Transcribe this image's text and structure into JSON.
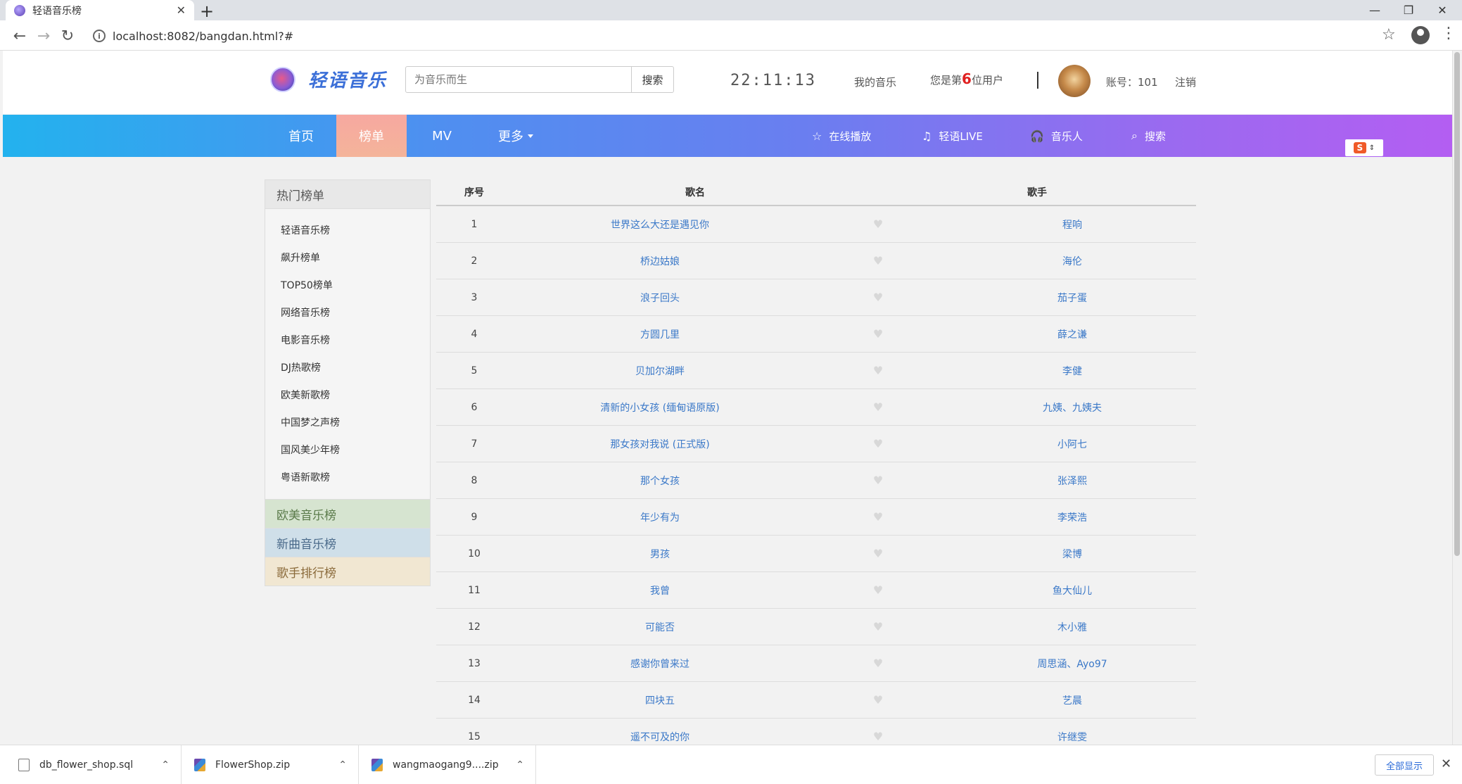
{
  "browser": {
    "tab_title": "轻语音乐榜",
    "url": "localhost:8082/bangdan.html?#"
  },
  "header": {
    "logo_text": "轻语音乐",
    "search_placeholder": "为音乐而生",
    "search_button": "搜索",
    "clock": "22:11:13",
    "my_music": "我的音乐",
    "user_prefix": "您是第",
    "user_count": "6",
    "user_suffix": "位用户",
    "account": "账号：101",
    "logout": "注销"
  },
  "nav": {
    "items": [
      "首页",
      "榜单",
      "MV",
      "更多"
    ],
    "active_index": 1,
    "right": [
      {
        "icon": "star-icon",
        "label": "在线播放"
      },
      {
        "icon": "music-note-icon",
        "label": "轻语LIVE"
      },
      {
        "icon": "headphones-icon",
        "label": "音乐人"
      },
      {
        "icon": "search-icon",
        "label": "搜索"
      }
    ]
  },
  "sidebar": {
    "heading": "热门榜单",
    "items": [
      "轻语音乐榜",
      "飙升榜单",
      "TOP50榜单",
      "网络音乐榜",
      "电影音乐榜",
      "DJ热歌榜",
      "欧美新歌榜",
      "中国梦之声榜",
      "国风美少年榜",
      "粤语新歌榜"
    ],
    "categories": [
      "欧美音乐榜",
      "新曲音乐榜",
      "歌手排行榜"
    ]
  },
  "table": {
    "headers": {
      "num": "序号",
      "song": "歌名",
      "artist": "歌手"
    },
    "rows": [
      {
        "num": "1",
        "song": "世界这么大还是遇见你",
        "artist": "程响"
      },
      {
        "num": "2",
        "song": "桥边姑娘",
        "artist": "海伦"
      },
      {
        "num": "3",
        "song": "浪子回头",
        "artist": "茄子蛋"
      },
      {
        "num": "4",
        "song": "方圆几里",
        "artist": "薛之谦"
      },
      {
        "num": "5",
        "song": "贝加尔湖畔",
        "artist": "李健"
      },
      {
        "num": "6",
        "song": "清新的小女孩 (缅甸语原版)",
        "artist": "九姨、九姨夫"
      },
      {
        "num": "7",
        "song": "那女孩对我说 (正式版)",
        "artist": "小阿七"
      },
      {
        "num": "8",
        "song": "那个女孩",
        "artist": "张泽熙"
      },
      {
        "num": "9",
        "song": "年少有为",
        "artist": "李荣浩"
      },
      {
        "num": "10",
        "song": "男孩",
        "artist": "梁博"
      },
      {
        "num": "11",
        "song": "我曾",
        "artist": "鱼大仙儿"
      },
      {
        "num": "12",
        "song": "可能否",
        "artist": "木小雅"
      },
      {
        "num": "13",
        "song": "感谢你曾来过",
        "artist": "周思涵、Ayo97"
      },
      {
        "num": "14",
        "song": "四块五",
        "artist": "艺晨"
      },
      {
        "num": "15",
        "song": "遥不可及的你",
        "artist": "许继雯"
      }
    ]
  },
  "downloads": {
    "items": [
      "db_flower_shop.sql",
      "FlowerShop.zip",
      "wangmaogang9....zip"
    ],
    "show_all": "全部显示"
  }
}
